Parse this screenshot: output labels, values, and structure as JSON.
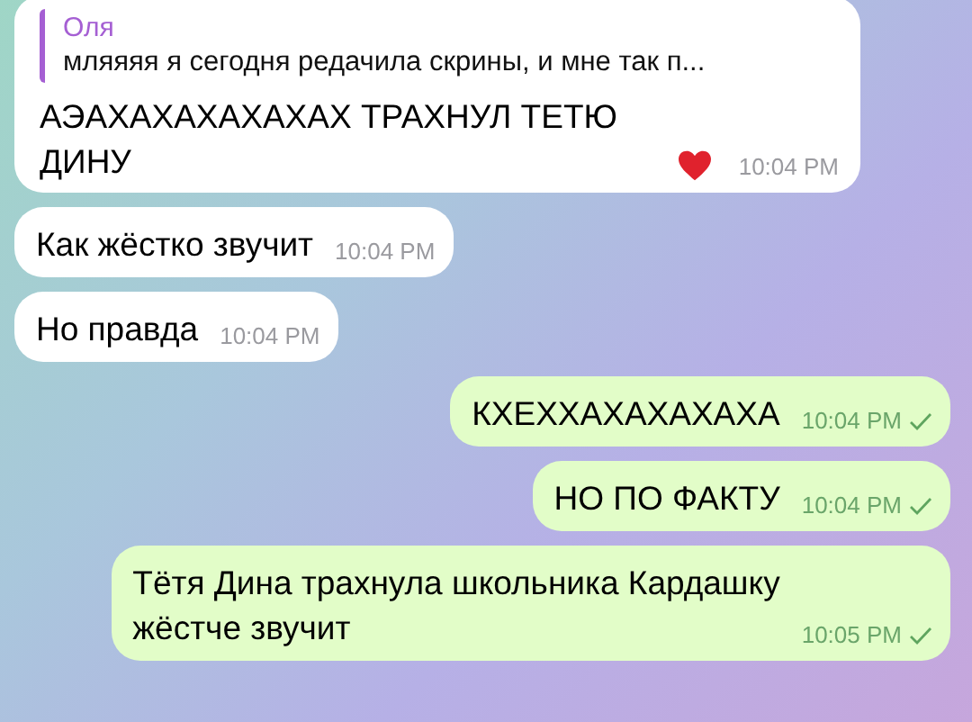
{
  "messages": [
    {
      "kind": "incoming",
      "reply": {
        "name": "Оля",
        "text": "мляяяя я сегодня редачила скрины, и мне так п..."
      },
      "text": "АЭАХАХАХАХАХАХ ТРАХНУЛ ТЕТЮ\nДИНУ",
      "liked": true,
      "time": "10:04 PM"
    },
    {
      "kind": "incoming",
      "text": "Как жёстко звучит",
      "time": "10:04 PM"
    },
    {
      "kind": "incoming",
      "text": "Но правда",
      "time": "10:04 PM"
    },
    {
      "kind": "outgoing",
      "text": "КХЕХХАХАХАХАХА",
      "time": "10:04 PM",
      "delivered": true
    },
    {
      "kind": "outgoing",
      "text": "НО ПО ФАКТУ",
      "time": "10:04 PM",
      "delivered": true
    },
    {
      "kind": "outgoing",
      "text": "Тётя Дина трахнула школьника Кардашку\nжёстче звучит",
      "time": "10:05 PM",
      "delivered": true
    }
  ]
}
